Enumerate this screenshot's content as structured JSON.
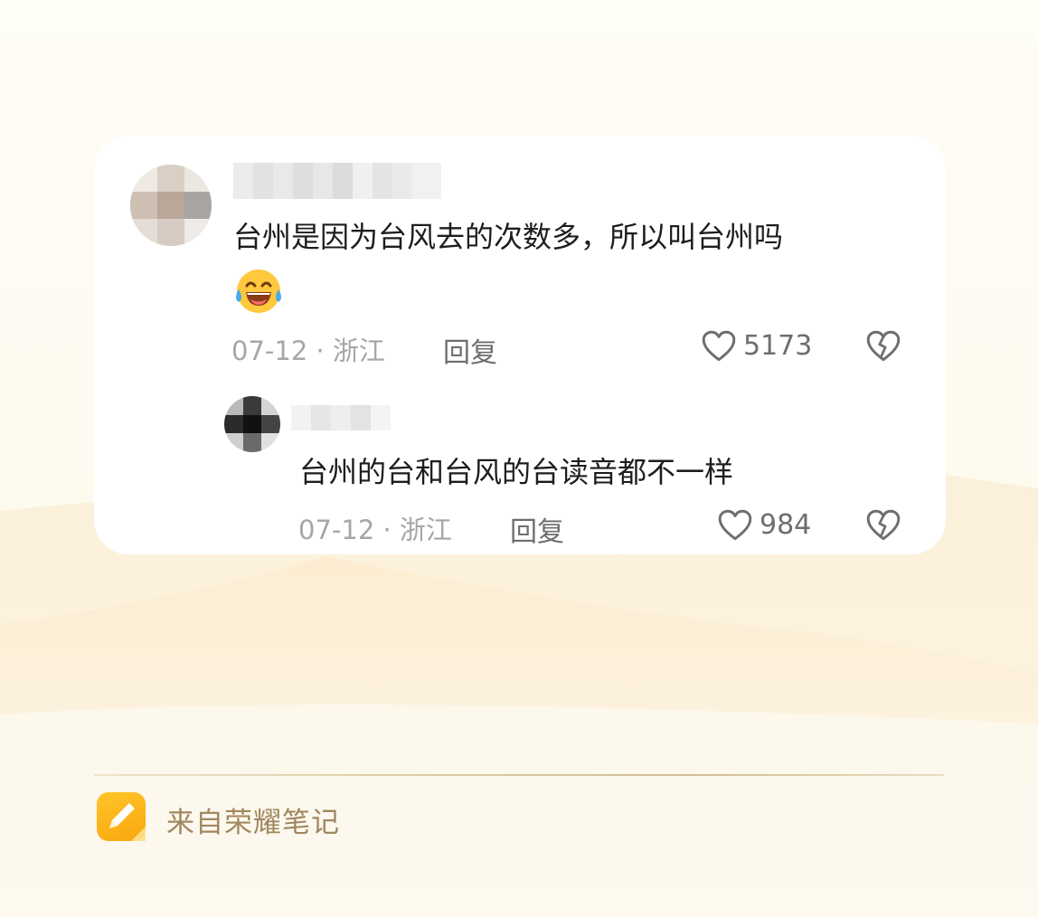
{
  "comment": {
    "text_line1": "台州是因为台风去的次数多，所以叫台州吗",
    "emoji": "laughing-crying-emoji",
    "date_location": "07-12 · 浙江",
    "reply_label": "回复",
    "like_count": "5173"
  },
  "reply": {
    "text": "台州的台和台风的台读音都不一样",
    "date_location": "07-12 · 浙江",
    "reply_label": "回复",
    "like_count": "984"
  },
  "footer": {
    "source_text": "来自荣耀笔记",
    "icon": "pencil-note-icon"
  },
  "colors": {
    "background": "#fdfbf3",
    "card": "#ffffff",
    "footer_text": "#a08760",
    "note_icon": "#ffb81c"
  }
}
